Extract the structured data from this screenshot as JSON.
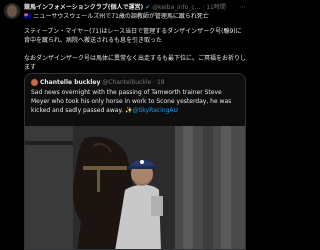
{
  "post": {
    "author_name": "競馬インフォメーションクラブ(個人で運営)",
    "verified_icon": "verified-badge-icon",
    "author_handle": "@keiba_info_c...",
    "separator": "·",
    "timestamp": "11時間",
    "more_icon": "more-options-icon",
    "text_line1": "🇦🇺 ニューサウスウェールズ州で71歳の調教師が管理馬に蹴られ死亡",
    "text_line2": "スティーブン・マイヤー(71)はレース当日で管理するダンザインザーク号(騸9)に背中を蹴られ、病院へ搬送されるも息を引き取った",
    "text_line3": "なおダンザインザーク号は馬体に異常なく出走するも最下位に。ご冥福をお祈りします"
  },
  "quoted": {
    "avatar_icon": "user-avatar-icon",
    "name": "Chantelle buckley",
    "handle": "@Chantelbuckle",
    "time": "18",
    "text": "Sad news overnight with the passing of Tamworth trainer Steve Meyer who took his only horse in work to Scone yesterday, he was kicked and sadly passed away.",
    "mention_icon": "sparkle-icon",
    "mention": "@SkyRacingAU"
  },
  "colors": {
    "background": "#000000",
    "text": "#e7e9ea",
    "secondary": "#71767b",
    "link": "#1d9bf0",
    "border": "#2f3336"
  }
}
